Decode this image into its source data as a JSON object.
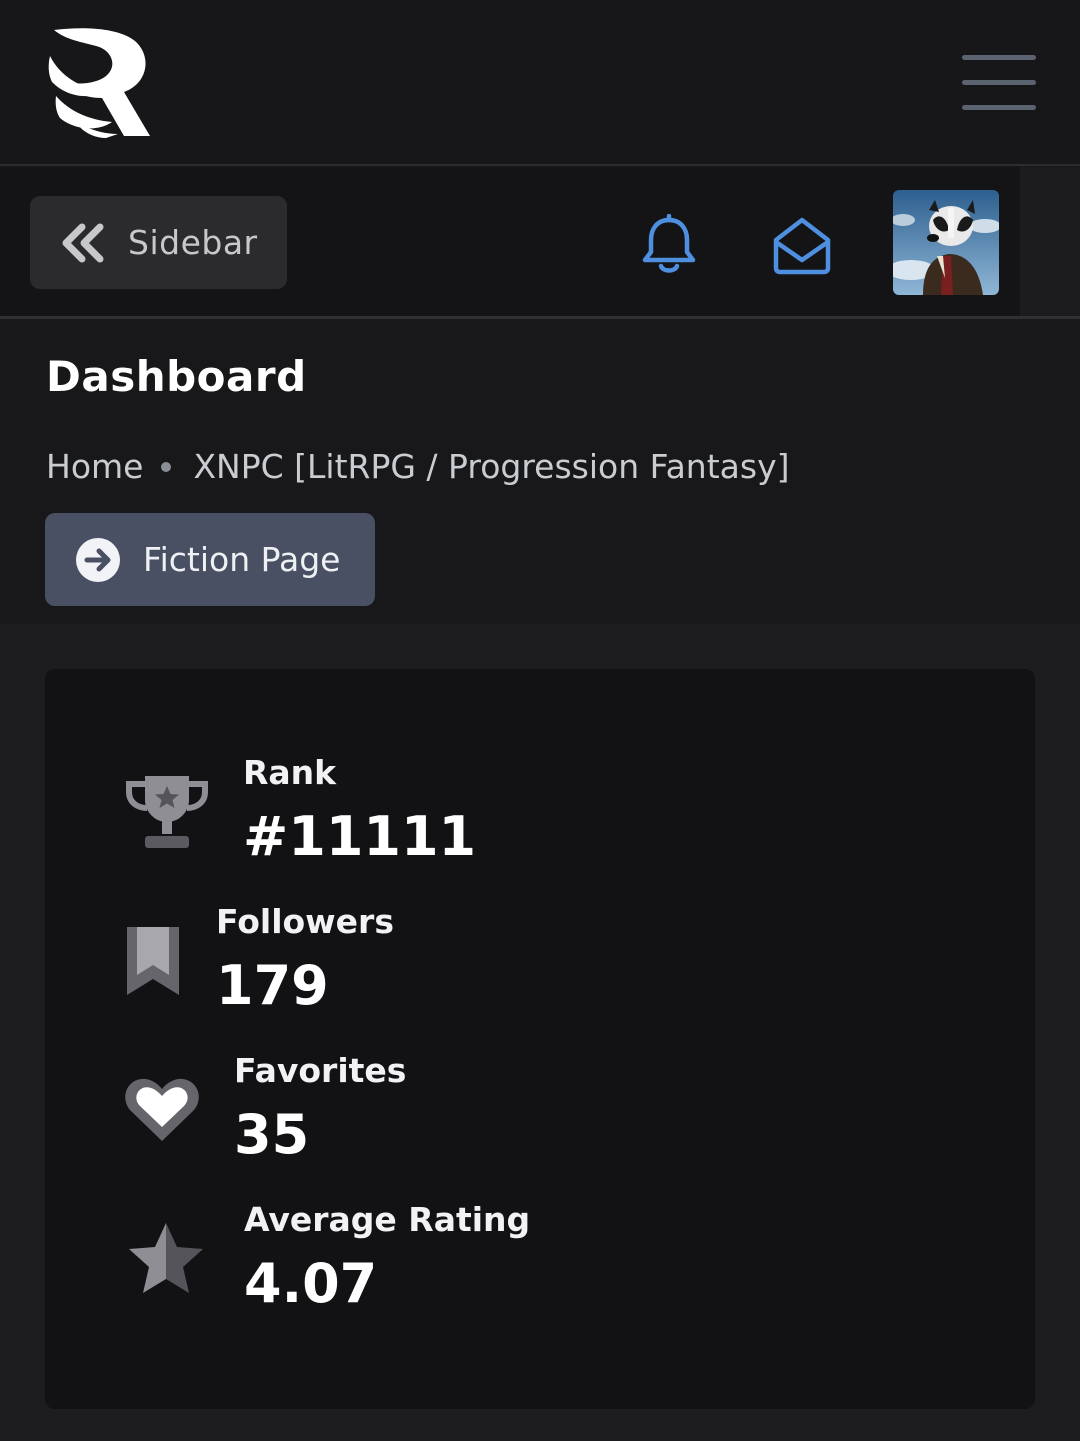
{
  "header": {
    "logo_name": "royal-road-logo",
    "menu_icon": "hamburger-icon"
  },
  "toolbar": {
    "sidebar_label": "Sidebar",
    "sidebar_icon": "double-chevron-left-icon",
    "notifications_icon": "bell-icon",
    "messages_icon": "envelope-open-icon",
    "avatar_name": "user-avatar"
  },
  "page": {
    "title": "Dashboard",
    "breadcrumb": [
      "Home",
      "XNPC [LitRPG / Progression Fantasy]"
    ],
    "fiction_button": "Fiction Page"
  },
  "stats": [
    {
      "label": "Rank",
      "value": "#11111",
      "icon": "trophy-icon"
    },
    {
      "label": "Followers",
      "value": "179",
      "icon": "bookmark-icon"
    },
    {
      "label": "Favorites",
      "value": "35",
      "icon": "heart-icon"
    },
    {
      "label": "Average Rating",
      "value": "4.07",
      "icon": "half-star-icon"
    }
  ],
  "colors": {
    "accent_blue": "#4f8fe0",
    "button_bg": "#4a5063",
    "icon_gray": "#8f8e94"
  }
}
